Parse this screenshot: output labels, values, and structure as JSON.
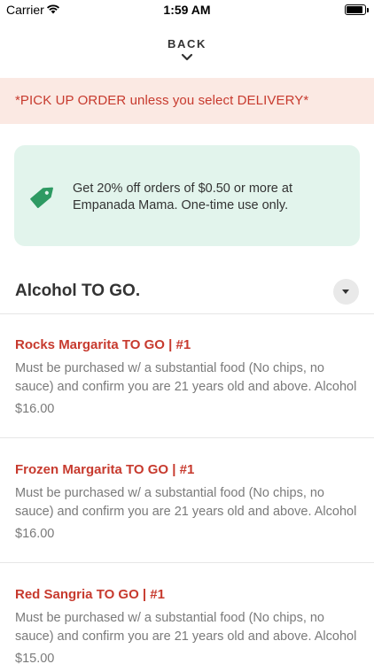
{
  "status_bar": {
    "carrier": "Carrier",
    "time": "1:59 AM",
    "battery_level": 0.9
  },
  "nav": {
    "back_label": "BACK"
  },
  "banner": {
    "text": "*PICK UP ORDER unless you select DELIVERY*"
  },
  "promo": {
    "text": "Get 20% off orders of $0.50 or more at Empanada Mama. One-time use only.",
    "icon": "tag-icon"
  },
  "section": {
    "title": "Alcohol TO GO."
  },
  "items": [
    {
      "name": "Rocks Margarita TO GO | #1",
      "description": "Must be purchased w/ a substantial food (No chips, no sauce) and confirm you are 21 years old and above. Alcohol",
      "price": "$16.00"
    },
    {
      "name": "Frozen Margarita TO GO | #1",
      "description": "Must be purchased w/ a substantial food (No chips, no sauce) and confirm you are 21 years old and above. Alcohol",
      "price": "$16.00"
    },
    {
      "name": "Red Sangria TO GO | #1",
      "description": "Must be purchased w/ a substantial food (No chips, no sauce) and confirm you are 21 years old and above. Alcohol",
      "price": "$15.00"
    }
  ],
  "colors": {
    "accent": "#c73a2e",
    "banner_bg": "#fbe9e3",
    "promo_bg": "#e2f4ec",
    "tag_green": "#2e9a63"
  }
}
